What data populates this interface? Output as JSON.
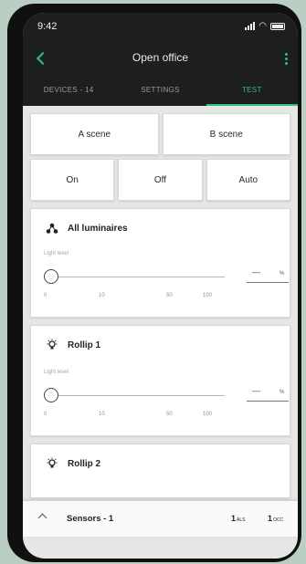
{
  "status_bar": {
    "time": "9:42"
  },
  "header": {
    "title": "Open office"
  },
  "tabs": [
    {
      "label": "DEVICES - 14",
      "active": false
    },
    {
      "label": "SETTINGS",
      "active": false
    },
    {
      "label": "TEST",
      "active": true
    }
  ],
  "scenes": {
    "a_label": "A scene",
    "b_label": "B scene"
  },
  "modes": {
    "on_label": "On",
    "off_label": "Off",
    "auto_label": "Auto"
  },
  "groups": [
    {
      "name": "All luminaires",
      "icon": "luminaires-group-icon",
      "level_label": "Light level",
      "ticks": [
        "0",
        "10",
        "50",
        "100"
      ],
      "value_display": "—",
      "unit": "%",
      "level": 0
    },
    {
      "name": "Rollip 1",
      "icon": "bulb-icon",
      "level_label": "Light level",
      "ticks": [
        "0",
        "10",
        "50",
        "100"
      ],
      "value_display": "—",
      "unit": "%",
      "level": 0
    },
    {
      "name": "Rollip 2",
      "icon": "bulb-icon"
    }
  ],
  "sensors_bar": {
    "label": "Sensors - 1",
    "count_als": "1",
    "als_unit": "ALS",
    "count_occ": "1",
    "occ_unit": "OCC"
  },
  "colors": {
    "accent": "#2ec07e",
    "appbar": "#1c1f1e",
    "background": "#e5e7e5"
  }
}
